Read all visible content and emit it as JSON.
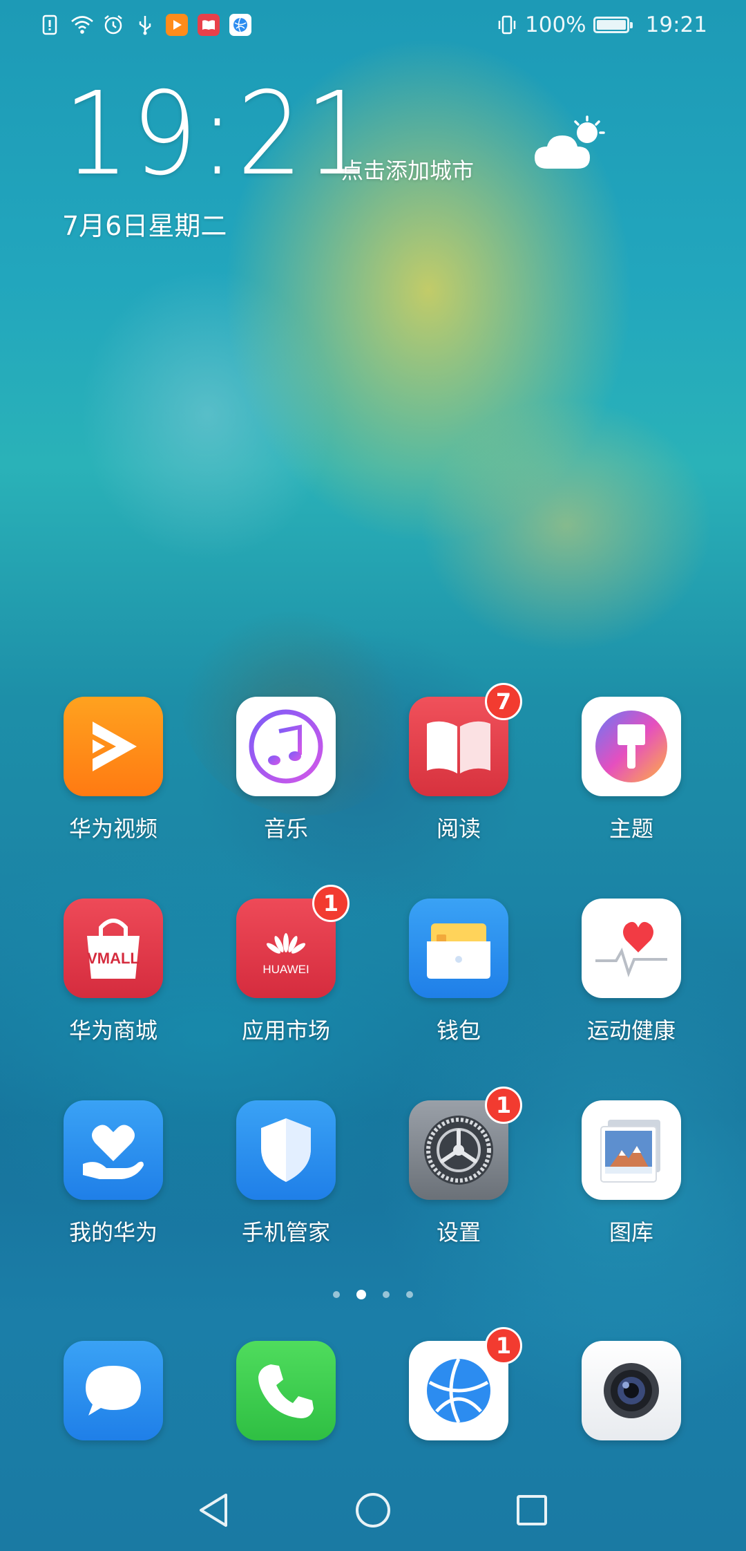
{
  "status_bar": {
    "battery_percent": "100%",
    "time": "19:21",
    "icons": [
      "alert-icon",
      "wifi-icon",
      "alarm-icon",
      "usb-icon",
      "huawei-video-notif-icon",
      "reader-notif-icon",
      "browser-notif-icon",
      "vibrate-icon",
      "battery-icon"
    ]
  },
  "clock_widget": {
    "time": "19:21",
    "add_city": "点击添加城市",
    "date": "7月6日星期二",
    "weather_icon": "partly-cloudy-icon"
  },
  "apps": [
    {
      "label": "华为视频",
      "icon": "huawei-video-icon",
      "badge": ""
    },
    {
      "label": "音乐",
      "icon": "music-icon",
      "badge": ""
    },
    {
      "label": "阅读",
      "icon": "reader-icon",
      "badge": "7"
    },
    {
      "label": "主题",
      "icon": "themes-icon",
      "badge": ""
    },
    {
      "label": "华为商城",
      "icon": "vmall-icon",
      "badge": ""
    },
    {
      "label": "应用市场",
      "icon": "appgallery-icon",
      "badge": "1"
    },
    {
      "label": "钱包",
      "icon": "wallet-icon",
      "badge": ""
    },
    {
      "label": "运动健康",
      "icon": "health-icon",
      "badge": ""
    },
    {
      "label": "我的华为",
      "icon": "my-huawei-icon",
      "badge": ""
    },
    {
      "label": "手机管家",
      "icon": "phone-manager-icon",
      "badge": ""
    },
    {
      "label": "设置",
      "icon": "settings-icon",
      "badge": "1"
    },
    {
      "label": "图库",
      "icon": "gallery-icon",
      "badge": ""
    }
  ],
  "icon_text": {
    "vmall": "VMALL",
    "huawei": "HUAWEI"
  },
  "page_indicator": {
    "pages": 4,
    "active": 1
  },
  "dock": [
    {
      "icon": "messages-icon",
      "badge": ""
    },
    {
      "icon": "phone-icon",
      "badge": ""
    },
    {
      "icon": "browser-icon",
      "badge": "1"
    },
    {
      "icon": "camera-icon",
      "badge": ""
    }
  ],
  "nav_bar": [
    "back-icon",
    "home-icon",
    "recents-icon"
  ],
  "colors": {
    "badge": "#f23b30",
    "video_orange": "#ff8c1a",
    "reader_red": "#e8404a",
    "vmall_red": "#e0374a",
    "phone_green": "#3fcf4f",
    "blue_app": "#2c8cf0"
  }
}
